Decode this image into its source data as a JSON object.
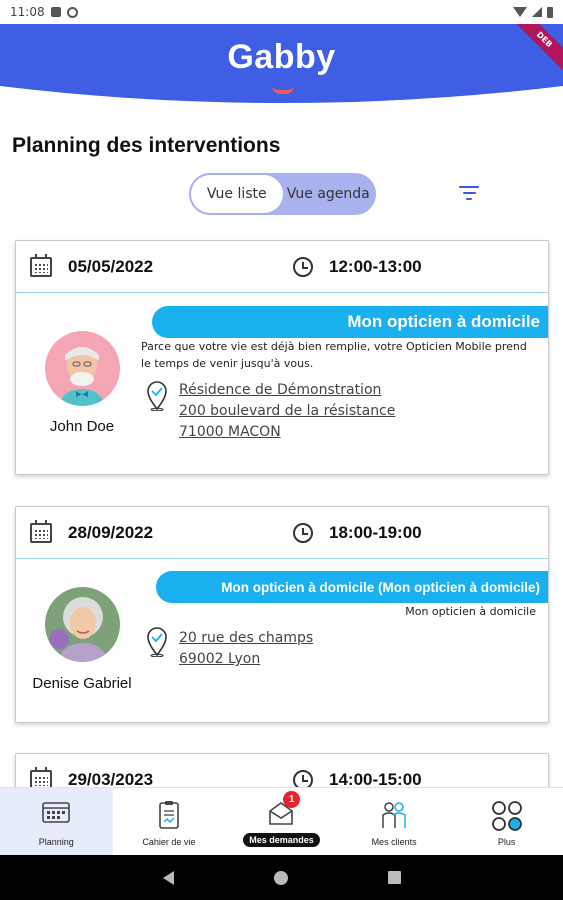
{
  "status": {
    "time": "11:08"
  },
  "header": {
    "logo_text": "Gabby",
    "ribbon": "DEB"
  },
  "page": {
    "title": "Planning des interventions"
  },
  "view_toggle": {
    "list_label": "Vue liste",
    "agenda_label": "Vue agenda",
    "active": "list"
  },
  "interventions": [
    {
      "date": "05/05/2022",
      "time": "12:00-13:00",
      "service": "Mon opticien à domicile",
      "description": "Parce que votre vie est déjà bien remplie, votre Opticien Mobile prend le temps de venir jusqu'à vous.",
      "address": [
        "Résidence de Démonstration",
        "200 boulevard de la résistance",
        "71000 MACON"
      ],
      "client": "John Doe"
    },
    {
      "date": "28/09/2022",
      "time": "18:00-19:00",
      "service": "Mon opticien à domicile (Mon opticien à domicile)",
      "subtitle": "Mon opticien à domicile",
      "address": [
        "20 rue des champs",
        "69002 Lyon"
      ],
      "client": "Denise Gabriel"
    },
    {
      "date": "29/03/2023",
      "time": "14:00-15:00"
    }
  ],
  "nav": {
    "items": [
      {
        "label": "Planning",
        "icon": "planning-icon"
      },
      {
        "label": "Cahier de vie",
        "icon": "notebook-icon"
      },
      {
        "label": "Mes demandes",
        "icon": "envelope-icon",
        "badge": "1"
      },
      {
        "label": "Mes clients",
        "icon": "clients-icon"
      },
      {
        "label": "Plus",
        "icon": "more-icon"
      }
    ]
  },
  "colors": {
    "brand_blue": "#3b57e0",
    "accent_cyan": "#1ab0f0",
    "toggle_bg": "#a9b2ef",
    "badge_red": "#e8232a"
  }
}
